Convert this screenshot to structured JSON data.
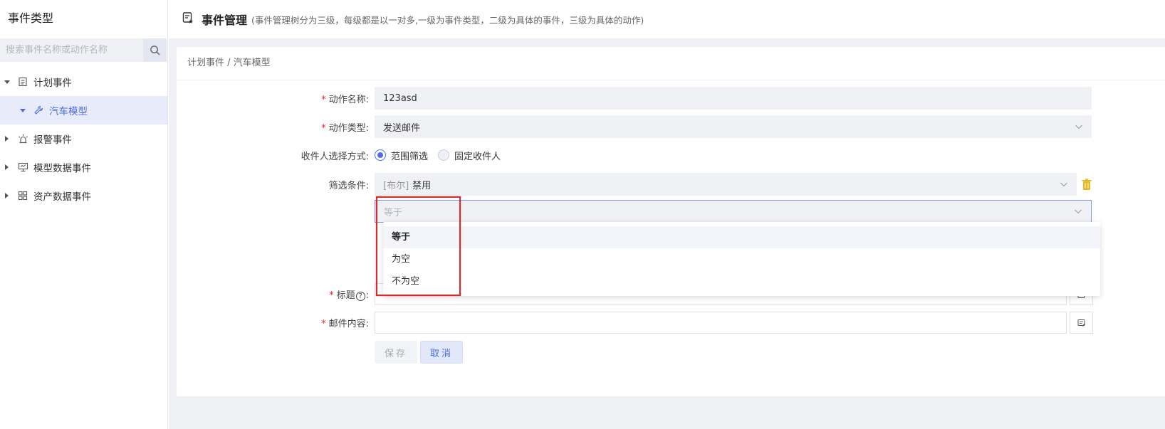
{
  "sidebar": {
    "title": "事件类型",
    "search_placeholder": "搜索事件名称或动作名称",
    "items": [
      {
        "label": "计划事件"
      },
      {
        "label": "汽车模型"
      },
      {
        "label": "报警事件"
      },
      {
        "label": "模型数据事件"
      },
      {
        "label": "资产数据事件"
      }
    ]
  },
  "header": {
    "title": "事件管理",
    "desc": "(事件管理树分为三级，每级都是以一对多,一级为事件类型，二级为具体的事件，三级为具体的动作)"
  },
  "breadcrumb": "计划事件 / 汽车模型",
  "form": {
    "required_mark": "*",
    "action_name_label": "动作名称:",
    "action_name_value": "123asd",
    "action_type_label": "动作类型:",
    "action_type_value": "发送邮件",
    "recipient_label": "收件人选择方式:",
    "radio_range": "范围筛选",
    "radio_fixed": "固定收件人",
    "filter_label": "筛选条件:",
    "filter_prefix": "[布尔]",
    "filter_value": "禁用",
    "operator_placeholder": "等于",
    "operator_options": [
      "等于",
      "为空",
      "不为空"
    ],
    "subject_label": "标题",
    "subject_help": "?",
    "subject_colon": ":",
    "content_label": "邮件内容:",
    "save_label": "保存",
    "cancel_label": "取消"
  },
  "colors": {
    "accent": "#4e6fe0",
    "highlight": "#d92b2b",
    "trash": "#e8b924"
  }
}
